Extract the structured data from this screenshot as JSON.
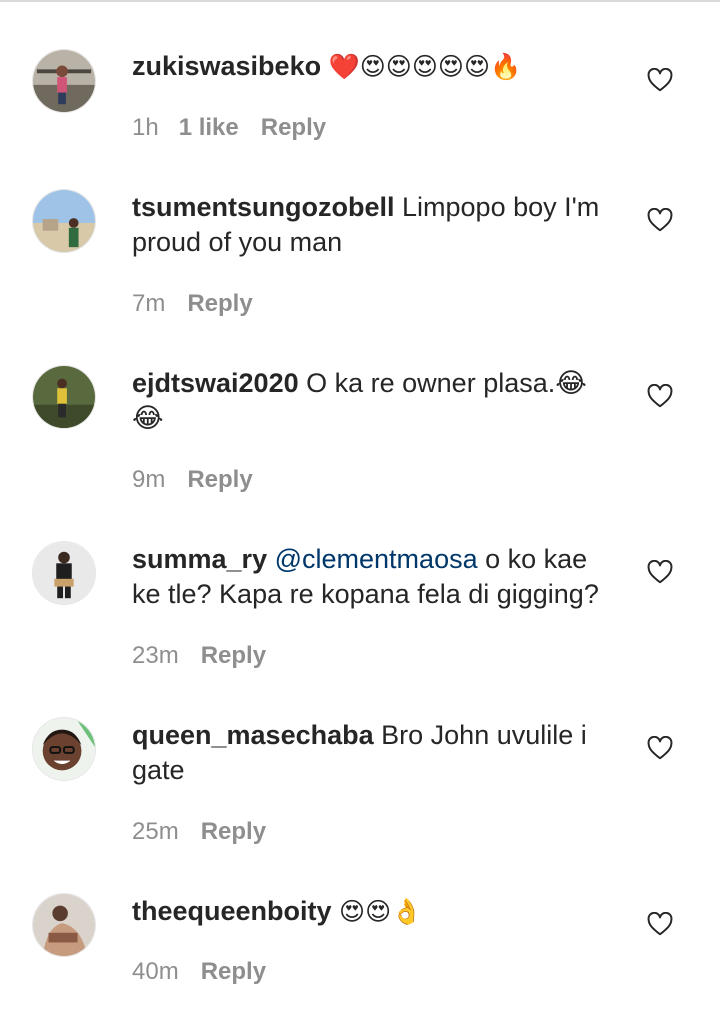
{
  "comments": [
    {
      "username": "zukiswasibeko",
      "text": "❤️😍😍😍😍😍🔥",
      "time": "1h",
      "likes": "1 like",
      "reply": "Reply"
    },
    {
      "username": "tsumentsungozobell",
      "text": "Limpopo boy I'm proud of you man",
      "time": "7m",
      "reply": "Reply"
    },
    {
      "username": "ejdtswai2020",
      "text": "O ka re owner plasa.😂😂",
      "time": "9m",
      "reply": "Reply"
    },
    {
      "username": "summa_ry",
      "mention": "@clementmaosa",
      "text": "o ko kae ke tle? Kapa re kopana fela di gigging?",
      "time": "23m",
      "reply": "Reply"
    },
    {
      "username": "queen_masechaba",
      "text": "Bro John uvulile i gate",
      "time": "25m",
      "reply": "Reply"
    },
    {
      "username": "theequeenboity",
      "text": "😍😍👌",
      "time": "40m",
      "reply": "Reply"
    }
  ],
  "icons": {
    "like": "heart-outline-icon"
  },
  "colors": {
    "text": "#262626",
    "meta": "#8e8e8e",
    "mention": "#00376b",
    "divider": "#d9d9d9"
  }
}
